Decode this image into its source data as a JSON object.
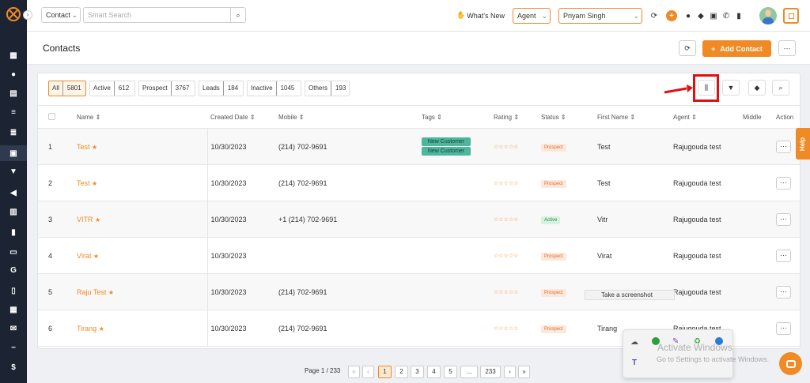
{
  "topbar": {
    "search_scope": "Contact",
    "search_placeholder": "Smart Search",
    "whats_new": "What's New",
    "role": "Agent",
    "user": "Priyam Singh"
  },
  "header": {
    "title": "Contacts",
    "add_contact": "Add Contact"
  },
  "filters": [
    {
      "label": "All",
      "count": "5801"
    },
    {
      "label": "Active",
      "count": "612"
    },
    {
      "label": "Prospect",
      "count": "3767"
    },
    {
      "label": "Leads",
      "count": "184"
    },
    {
      "label": "Inactive",
      "count": "1045"
    },
    {
      "label": "Others",
      "count": "193"
    }
  ],
  "table": {
    "columns": {
      "name": "Name",
      "created": "Created Date",
      "mobile": "Mobile",
      "tags": "Tags",
      "rating": "Rating",
      "status": "Status",
      "first_name": "First Name",
      "agent": "Agent",
      "middle": "Middle",
      "action": "Action"
    },
    "rows": [
      {
        "num": "1",
        "name": "Test",
        "created": "10/30/2023",
        "mobile": "(214) 702-9691",
        "tags": [
          "New Customer",
          "New Customer"
        ],
        "rating": "☆☆☆☆☆",
        "status": "Prospect",
        "first_name": "Test",
        "agent": "Rajugouda test"
      },
      {
        "num": "2",
        "name": "Test",
        "created": "10/30/2023",
        "mobile": "(214) 702-9691",
        "tags": [],
        "rating": "☆☆☆☆☆",
        "status": "Prospect",
        "first_name": "Test",
        "agent": "Rajugouda test"
      },
      {
        "num": "3",
        "name": "VITR",
        "created": "10/30/2023",
        "mobile": "+1 (214) 702-9691",
        "tags": [],
        "rating": "☆☆☆☆☆",
        "status": "Active",
        "first_name": "Vitr",
        "agent": "Rajugouda test"
      },
      {
        "num": "4",
        "name": "Virat",
        "created": "10/30/2023",
        "mobile": "",
        "tags": [],
        "rating": "☆☆☆☆☆",
        "status": "Prospect",
        "first_name": "Virat",
        "agent": "Rajugouda test"
      },
      {
        "num": "5",
        "name": "Raju Test",
        "created": "10/30/2023",
        "mobile": "(214) 702-9691",
        "tags": [],
        "rating": "☆☆☆☆☆",
        "status": "Prospect",
        "first_name": "",
        "agent": "Rajugouda test"
      },
      {
        "num": "6",
        "name": "Tirang",
        "created": "10/30/2023",
        "mobile": "(214) 702-9691",
        "tags": [],
        "rating": "☆☆☆☆☆",
        "status": "Prospect",
        "first_name": "Tirang",
        "agent": "Rajugouda test"
      }
    ]
  },
  "pagination": {
    "info": "Page 1 / 233",
    "pages": [
      "1",
      "2",
      "3",
      "4",
      "5",
      "...",
      "233"
    ]
  },
  "tooltip": "Take a screenshot",
  "help_tab": "Help",
  "watermark": {
    "title": "Activate Windows",
    "subtitle": "Go to Settings to activate Windows."
  },
  "colors": {
    "accent": "#f08a24",
    "sidebar": "#1c2433",
    "highlight": "#e01010"
  }
}
